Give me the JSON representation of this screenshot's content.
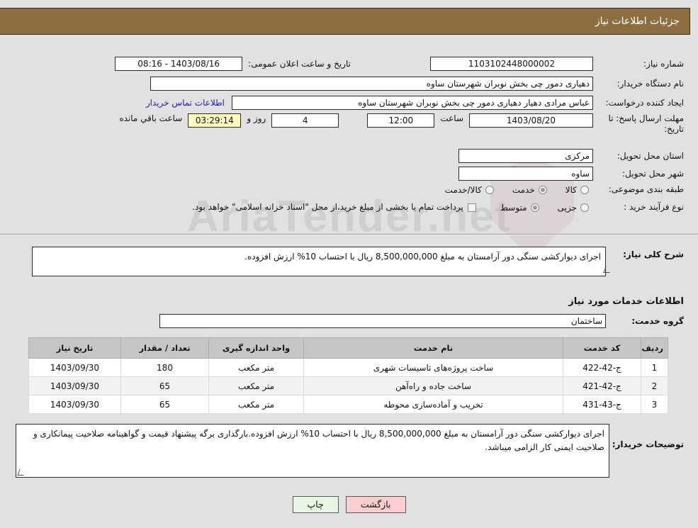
{
  "header": {
    "title": "جزئیات اطلاعات نیاز"
  },
  "watermark": {
    "text": "AriaTender.net"
  },
  "form": {
    "need_number_label": "شماره نیاز:",
    "need_number_value": "1103102448000002",
    "announce_datetime_label": "تاریخ و ساعت اعلان عمومی:",
    "announce_datetime_value": "1403/08/16 - 08:16",
    "buyer_org_label": "نام دستگاه خریدار:",
    "buyer_org_value": "دهیاری دمور چی  بخش نوبران شهرستان ساوه",
    "requester_label": "ایجاد کننده درخواست:",
    "requester_value": "عباس مرادی دهیار دهیاری دمور چی  بخش نوبران شهرستان ساوه",
    "contact_link": "اطلاعات تماس خریدار",
    "deadline_label": "مهلت ارسال پاسخ: تا تاریخ:",
    "deadline_date": "1403/08/20",
    "deadline_hour_label": "ساعت",
    "deadline_hour_value": "12:00",
    "days_value": "4",
    "days_label": "روز و",
    "remaining_time_value": "03:29:14",
    "remaining_label": "ساعت باقي مانده",
    "province_label": "استان محل تحویل:",
    "province_value": "مرکزی",
    "city_label": "شهر محل تحویل:",
    "city_value": "ساوه",
    "category_label": "طبقه بندی موضوعی:",
    "category_options": [
      {
        "label": "کالا",
        "selected": false
      },
      {
        "label": "خدمت",
        "selected": true
      },
      {
        "label": "کالا/خدمت",
        "selected": false
      }
    ],
    "process_label": "نوع فرآیند خرید :",
    "process_options": [
      {
        "label": "جزیی",
        "selected": false
      },
      {
        "label": "متوسط",
        "selected": true
      }
    ],
    "treasury_checkbox_checked": false,
    "treasury_note": "پرداخت تمام یا بخشی از مبلغ خرید،از محل \"اسناد خزانه اسلامی\" خواهد بود."
  },
  "need_summary": {
    "label": "شرح کلی نیاز:",
    "value": "اجرای دیوارکشی سنگی دور آرامستان به مبلغ 8,500,000,000 ریال با احتساب 10% ارزش افزوده."
  },
  "services_section": {
    "heading": "اطلاعات خدمات مورد نیاز",
    "group_label": "گروه خدمت:",
    "group_value": "ساختمان"
  },
  "table": {
    "columns": [
      "ردیف",
      "کد خدمت",
      "نام خدمت",
      "واحد اندازه گیری",
      "تعداد / مقدار",
      "تاریخ نیاز"
    ],
    "rows": [
      {
        "index": "1",
        "code": "ج-42-422",
        "name": "ساخت پروژه‌های تاسیسات شهری",
        "unit": "متر مکعب",
        "quantity": "180",
        "date": "1403/09/30"
      },
      {
        "index": "2",
        "code": "ج-42-421",
        "name": "ساخت جاده و راه‌آهن",
        "unit": "متر مکعب",
        "quantity": "65",
        "date": "1403/09/30"
      },
      {
        "index": "3",
        "code": "ج-43-431",
        "name": "تخریب و آماده‌سازی محوطه",
        "unit": "متر مکعب",
        "quantity": "65",
        "date": "1403/09/30"
      }
    ]
  },
  "buyer_notes": {
    "label": "توضیحات خریدار:",
    "value": "اجرای دیوارکشی سنگی دور آرامستان به مبلغ 8,500,000,000 ریال با احتساب 10% ارزش افزوده.بارگذاری برگه پیشنهاد قیمت و گواهینامه صلاحیت پیمانکاری و صلاحیت ایمنی کار الزامی میباشد."
  },
  "footer": {
    "print_label": "چاپ",
    "back_label": "بازگشت"
  }
}
